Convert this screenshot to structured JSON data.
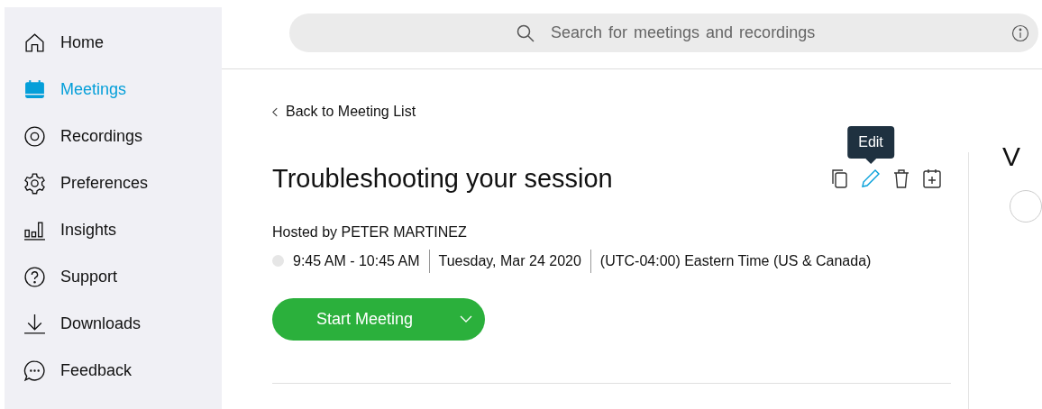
{
  "sidebar": {
    "items": [
      {
        "label": "Home",
        "kind": "home",
        "selected": false
      },
      {
        "label": "Meetings",
        "kind": "calendar",
        "selected": true
      },
      {
        "label": "Recordings",
        "kind": "disc",
        "selected": false
      },
      {
        "label": "Preferences",
        "kind": "gear",
        "selected": false
      },
      {
        "label": "Insights",
        "kind": "bars",
        "selected": false
      },
      {
        "label": "Support",
        "kind": "help",
        "selected": false
      },
      {
        "label": "Downloads",
        "kind": "download",
        "selected": false
      },
      {
        "label": "Feedback",
        "kind": "chat",
        "selected": false
      }
    ]
  },
  "search": {
    "placeholder": "Search for meetings and recordings"
  },
  "back_link": "Back to Meeting List",
  "meeting": {
    "title": "Troubleshooting your session",
    "host": "Hosted by PETER MARTINEZ",
    "time": "9:45 AM - 10:45 AM",
    "date": "Tuesday, Mar 24 2020",
    "timezone": "(UTC-04:00) Eastern Time (US & Canada)",
    "actions": [
      {
        "kind": "copy",
        "selected": false
      },
      {
        "kind": "pencil",
        "selected": true,
        "tooltip": "Edit"
      },
      {
        "kind": "trash",
        "selected": false
      },
      {
        "kind": "calendar-add",
        "selected": false
      }
    ],
    "start_button": "Start Meeting"
  },
  "side_panel": {
    "heading": "V"
  }
}
